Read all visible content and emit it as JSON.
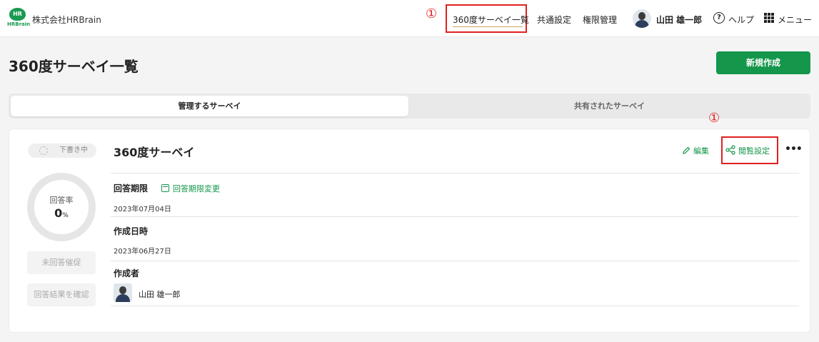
{
  "header": {
    "logo_text": "HR",
    "logo_word": "HRBrain",
    "company": "株式会社HRBrain",
    "nav": [
      "360度サーベイ一覧",
      "共通設定",
      "権限管理"
    ],
    "user_name": "山田 雄一郎",
    "help": "ヘルプ",
    "menu": "メニュー",
    "marker": "①"
  },
  "page": {
    "title": "360度サーベイ一覧",
    "new_button": "新規作成"
  },
  "tabs": [
    "管理するサーベイ",
    "共有されたサーベイ"
  ],
  "card": {
    "status": "下書き中",
    "rate_label": "回答率",
    "rate_value": "0",
    "rate_unit": "%",
    "remind_button": "未回答催促",
    "results_button": "回答結果を確認",
    "title": "360度サーベイ",
    "edit": "編集",
    "view_settings": "閲覧設定",
    "marker": "①",
    "deadline_label": "回答期限",
    "deadline_change": "回答期限変更",
    "deadline_value": "2023年07月04日",
    "created_label": "作成日時",
    "created_value": "2023年06月27日",
    "creator_label": "作成者",
    "creator_name": "山田 雄一郎"
  },
  "colors": {
    "accent": "#14964b",
    "annotation": "#e02020"
  }
}
